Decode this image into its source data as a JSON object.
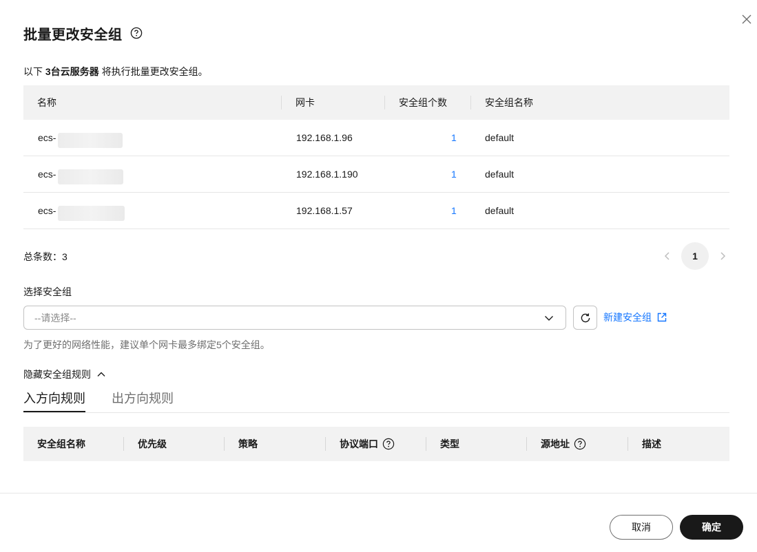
{
  "dialog": {
    "title": "批量更改安全组",
    "intro_prefix": "以下",
    "intro_bold": "3台云服务器",
    "intro_suffix": "将执行批量更改安全组。"
  },
  "servers": {
    "columns": [
      "名称",
      "网卡",
      "安全组个数",
      "安全组名称"
    ],
    "rows": [
      {
        "name": "ecs-",
        "nic": "192.168.1.96",
        "count": "1",
        "sg": "default"
      },
      {
        "name": "ecs-",
        "nic": "192.168.1.190",
        "count": "1",
        "sg": "default"
      },
      {
        "name": "ecs-",
        "nic": "192.168.1.57",
        "count": "1",
        "sg": "default"
      }
    ],
    "total_label": "总条数：3",
    "current_page": "1"
  },
  "select_sg": {
    "label": "选择安全组",
    "placeholder": "--请选择--",
    "new_link": "新建安全组",
    "hint": "为了更好的网络性能，建议单个网卡最多绑定5个安全组。"
  },
  "rules": {
    "toggle_label": "隐藏安全组规则",
    "tabs": [
      "入方向规则",
      "出方向规则"
    ],
    "columns": [
      "安全组名称",
      "优先级",
      "策略",
      "协议端口",
      "类型",
      "源地址",
      "描述"
    ]
  },
  "footer": {
    "cancel": "取消",
    "confirm": "确定"
  },
  "colors": {
    "link": "#1476ff",
    "primary_button": "#191919",
    "header_bg": "#f2f2f2"
  }
}
